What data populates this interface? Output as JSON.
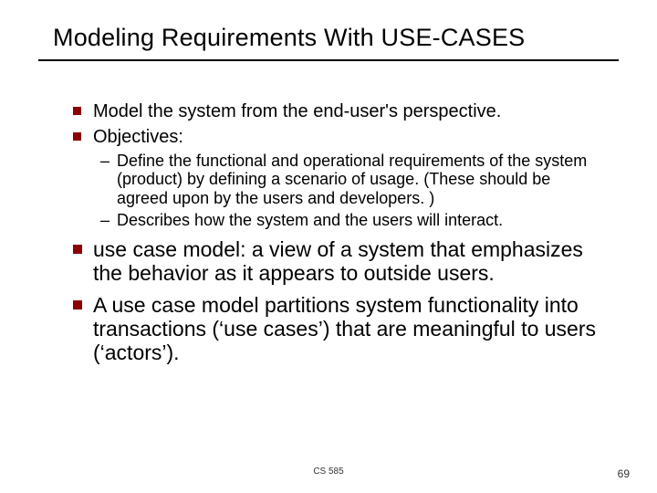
{
  "title": "Modeling Requirements With USE-CASES",
  "bullets": {
    "b1": "Model the system from the end-user's perspective.",
    "b2": "Objectives:",
    "sub1": "Define the functional and operational requirements of the system (product) by defining a scenario of usage. (These should be agreed upon by the users and developers. )",
    "sub2": "Describes how the system and the users will interact.",
    "b3": "use case model: a view of a system that emphasizes the behavior as it appears to outside users.",
    "b4": "A use case model partitions system functionality into transactions (‘use cases’) that are meaningful to users (‘actors’)."
  },
  "footer": {
    "course": "CS 585",
    "page": "69"
  }
}
